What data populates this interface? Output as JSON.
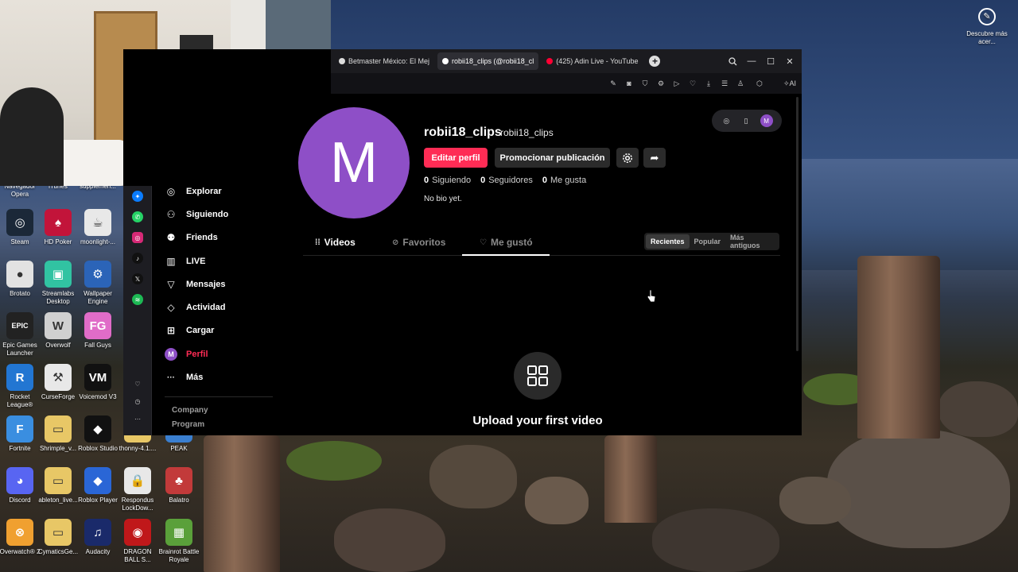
{
  "desktop": {
    "widget_label": "Descubre más acer...",
    "icons": [
      {
        "label": "Navegador Opera",
        "color": "#c0182a",
        "glyph": "O"
      },
      {
        "label": "iTunes",
        "color": "#e0e0e0",
        "glyph": "♪"
      },
      {
        "label": "supplemen...",
        "color": "#6a6a6a",
        "glyph": "▤"
      },
      {
        "label": "Steam",
        "color": "#1b2838",
        "glyph": "◎"
      },
      {
        "label": "HD Poker",
        "color": "#c2143a",
        "glyph": "♠"
      },
      {
        "label": "moonlight-...",
        "color": "#e8e8e8",
        "glyph": "☕"
      },
      {
        "label": "Brotato",
        "color": "#e2e2e2",
        "glyph": "●"
      },
      {
        "label": "Streamlabs Desktop",
        "color": "#31c3a2",
        "glyph": "▣"
      },
      {
        "label": "Wallpaper Engine",
        "color": "#2b64b8",
        "glyph": "⚙"
      },
      {
        "label": "Epic Games Launcher",
        "color": "#222",
        "glyph": "EPIC"
      },
      {
        "label": "Overwolf",
        "color": "#d0d0d0",
        "glyph": "W"
      },
      {
        "label": "Fall Guys",
        "color": "#e06cc8",
        "glyph": "FG"
      },
      {
        "label": "Rocket League®",
        "color": "#2276d2",
        "glyph": "R"
      },
      {
        "label": "CurseForge",
        "color": "#e8e8e8",
        "glyph": "⚒"
      },
      {
        "label": "Voicemod V3",
        "color": "#111",
        "glyph": "VM"
      },
      {
        "label": "Fortnite",
        "color": "#3a8ee0",
        "glyph": "F"
      },
      {
        "label": "Shrimple_v...",
        "color": "#e8c766",
        "glyph": "▭"
      },
      {
        "label": "Roblox Studio",
        "color": "#111",
        "glyph": "◆"
      },
      {
        "label": "thonny-4.1....",
        "color": "#e8c766",
        "glyph": "▭"
      },
      {
        "label": "PEAK",
        "color": "#3a7fd0",
        "glyph": "▲"
      },
      {
        "label": "Discord",
        "color": "#5865f2",
        "glyph": "◕"
      },
      {
        "label": "ableton_live...",
        "color": "#e8c766",
        "glyph": "▭"
      },
      {
        "label": "Roblox Player",
        "color": "#2a66d6",
        "glyph": "◆"
      },
      {
        "label": "Respondus LockDow...",
        "color": "#e8e8e8",
        "glyph": "🔒"
      },
      {
        "label": "Balatro",
        "color": "#c23a3a",
        "glyph": "♣"
      },
      {
        "label": "Overwatch® 2",
        "color": "#f0a030",
        "glyph": "⊗"
      },
      {
        "label": "CymaticsGe...",
        "color": "#e8c766",
        "glyph": "▭"
      },
      {
        "label": "Audacity",
        "color": "#1a2a6a",
        "glyph": "♫"
      },
      {
        "label": "DRAGON BALL S...",
        "color": "#c0181a",
        "glyph": "◉"
      },
      {
        "label": "Brainrot Battle Royale",
        "color": "#5aa03a",
        "glyph": "▦"
      }
    ]
  },
  "browser": {
    "tabs": [
      {
        "label": "Betmaster México: El Mej",
        "favicon_color": "#dcdcdc",
        "active": false
      },
      {
        "label": "robii18_clips (@robii18_cl",
        "favicon_color": "#ffffff",
        "active": true
      },
      {
        "label": "(425) Adin Live - YouTube",
        "favicon_color": "#ff0033",
        "active": false
      }
    ],
    "ai_label": "AI"
  },
  "tiktok": {
    "nav": [
      {
        "label": "Explorar",
        "icon": "compass-icon",
        "glyph": "◎"
      },
      {
        "label": "Siguiendo",
        "icon": "following-icon",
        "glyph": "⚇"
      },
      {
        "label": "Friends",
        "icon": "friends-icon",
        "glyph": "⚉"
      },
      {
        "label": "LIVE",
        "icon": "live-icon",
        "glyph": "▥"
      },
      {
        "label": "Mensajes",
        "icon": "messages-icon",
        "glyph": "▽"
      },
      {
        "label": "Actividad",
        "icon": "activity-icon",
        "glyph": "◇"
      },
      {
        "label": "Cargar",
        "icon": "upload-icon",
        "glyph": "⊞"
      },
      {
        "label": "Perfil",
        "icon": "profile-avatar",
        "glyph": "M"
      },
      {
        "label": "Más",
        "icon": "more-icon",
        "glyph": "···"
      }
    ],
    "footer": [
      "Company",
      "Program"
    ],
    "profile": {
      "avatar_letter": "M",
      "username": "robii18_clips",
      "handle": "robii18_clips",
      "edit_button": "Editar perfil",
      "promote_button": "Promocionar publicación",
      "following_count": "0",
      "following_label": "Siguiendo",
      "followers_count": "0",
      "followers_label": "Seguidores",
      "likes_count": "0",
      "likes_label": "Me gusta",
      "bio": "No bio yet."
    },
    "content_tabs": [
      {
        "label": "Videos",
        "glyph": "⁞⁞"
      },
      {
        "label": "Favoritos",
        "glyph": "⊘"
      },
      {
        "label": "Me gustó",
        "glyph": "♡"
      }
    ],
    "sort": [
      "Recientes",
      "Popular",
      "Más antiguos"
    ],
    "empty_title": "Upload your first video",
    "accent_color": "#fe2c55"
  }
}
